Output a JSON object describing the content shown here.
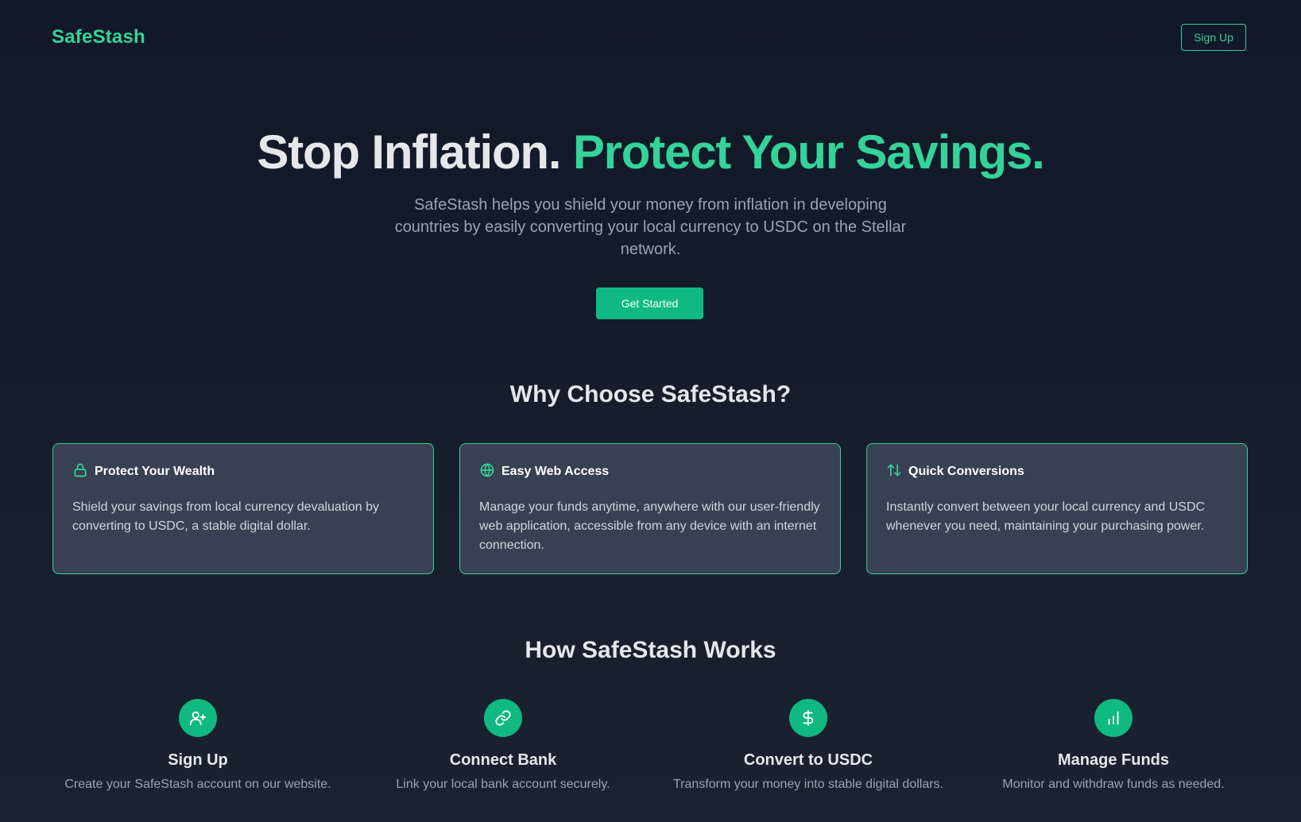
{
  "header": {
    "logo": "SafeStash",
    "signup_label": "Sign Up"
  },
  "hero": {
    "title_main": "Stop Inflation.",
    "title_accent": "Protect Your Savings.",
    "subtitle": "SafeStash helps you shield your money from inflation in developing countries by easily converting your local currency to USDC on the Stellar network.",
    "cta_label": "Get Started"
  },
  "why": {
    "title": "Why Choose SafeStash?",
    "features": [
      {
        "icon": "lock-icon",
        "title": "Protect Your Wealth",
        "description": "Shield your savings from local currency devaluation by converting to USDC, a stable digital dollar."
      },
      {
        "icon": "globe-icon",
        "title": "Easy Web Access",
        "description": "Manage your funds anytime, anywhere with our user-friendly web application, accessible from any device with an internet connection."
      },
      {
        "icon": "arrows-up-down-icon",
        "title": "Quick Conversions",
        "description": "Instantly convert between your local currency and USDC whenever you need, maintaining your purchasing power."
      }
    ]
  },
  "how": {
    "title": "How SafeStash Works",
    "steps": [
      {
        "icon": "user-plus-icon",
        "title": "Sign Up",
        "description": "Create your SafeStash account on our website."
      },
      {
        "icon": "link-icon",
        "title": "Connect Bank",
        "description": "Link your local bank account securely."
      },
      {
        "icon": "dollar-icon",
        "title": "Convert to USDC",
        "description": "Transform your money into stable digital dollars."
      },
      {
        "icon": "bar-chart-icon",
        "title": "Manage Funds",
        "description": "Monitor and withdraw funds as needed."
      }
    ]
  },
  "colors": {
    "accent": "#34d399",
    "button": "#10b981",
    "background": "#111827",
    "card": "#374151"
  }
}
